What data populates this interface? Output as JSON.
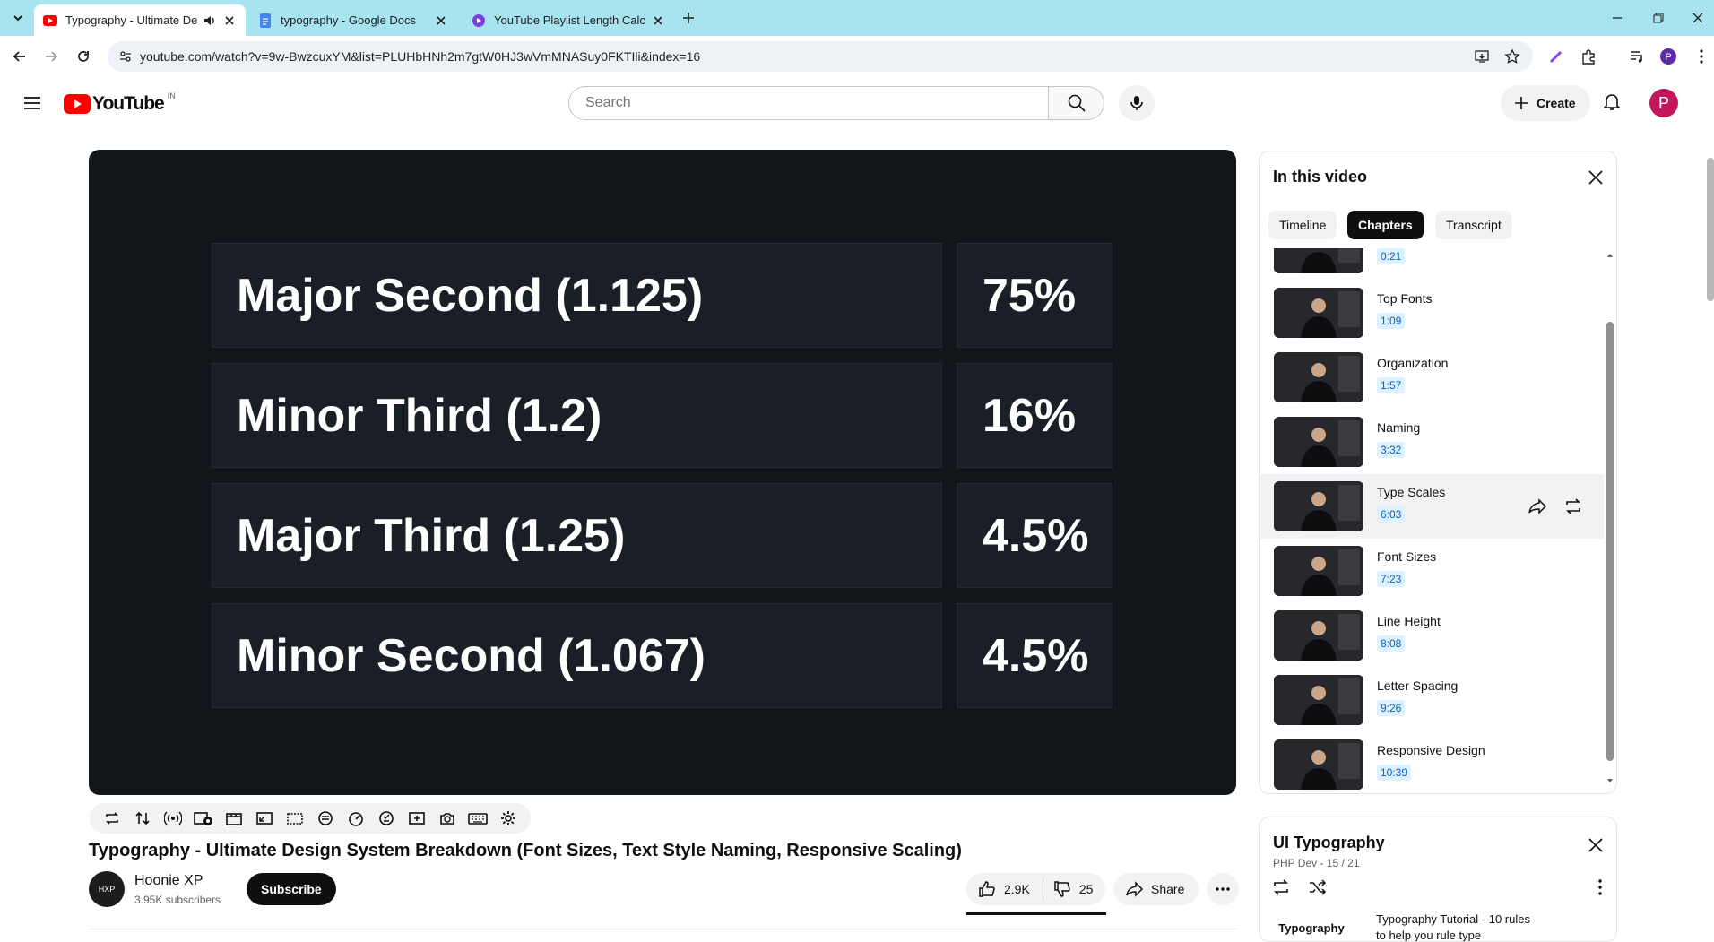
{
  "browser": {
    "tabs": [
      {
        "title": "Typography - Ultimate Desi",
        "active": true,
        "audio": true
      },
      {
        "title": "typography - Google Docs",
        "active": false
      },
      {
        "title": "YouTube Playlist Length Calcula",
        "active": false
      }
    ],
    "url": "youtube.com/watch?v=9w-BwzcuxYM&list=PLUHbHNh2m7gtW0HJ3wVmMNASuy0FKTIli&index=16"
  },
  "youtube": {
    "logo_text": "YouTube",
    "region": "IN",
    "search_placeholder": "Search",
    "create_label": "Create",
    "avatar_letter": "P"
  },
  "video": {
    "rows": [
      {
        "name": "Major Second (1.125)",
        "pct": "75%"
      },
      {
        "name": "Minor Third (1.2)",
        "pct": "16%"
      },
      {
        "name": "Major Third (1.25)",
        "pct": "4.5%"
      },
      {
        "name": "Minor Second (1.067)",
        "pct": "4.5%"
      }
    ],
    "title": "Typography - Ultimate Design System Breakdown (Font Sizes, Text Style Naming, Responsive Scaling)",
    "channel": "Hoonie XP",
    "channel_avatar_text": "HXP",
    "subscribers": "3.95K subscribers",
    "subscribe_label": "Subscribe",
    "likes": "2.9K",
    "dislikes": "25",
    "share_label": "Share"
  },
  "chapters_panel": {
    "title": "In this video",
    "tabs": [
      "Timeline",
      "Chapters",
      "Transcript"
    ],
    "selected_tab": "Chapters",
    "partial_first_time": "0:21",
    "items": [
      {
        "name": "Top Fonts",
        "time": "1:09"
      },
      {
        "name": "Organization",
        "time": "1:57"
      },
      {
        "name": "Naming",
        "time": "3:32"
      },
      {
        "name": "Type Scales",
        "time": "6:03",
        "current": true
      },
      {
        "name": "Font Sizes",
        "time": "7:23"
      },
      {
        "name": "Line Height",
        "time": "8:08"
      },
      {
        "name": "Letter Spacing",
        "time": "9:26"
      },
      {
        "name": "Responsive Design",
        "time": "10:39"
      }
    ]
  },
  "playlist_panel": {
    "title": "UI Typography",
    "meta": "PHP Dev - 15 / 21",
    "first_item_thumb_text": "Typography",
    "first_item_title": "Typography Tutorial - 10 rules",
    "first_item_title_line2": "to help you rule type"
  },
  "colors": {
    "tabstrip": "#a8e4ef",
    "youtube_red": "#ff0000",
    "avatar": "#c2185b",
    "video_bg": "#12151a",
    "timestamp_chip_bg": "#def1ff",
    "timestamp_chip_text": "#065fd4"
  }
}
